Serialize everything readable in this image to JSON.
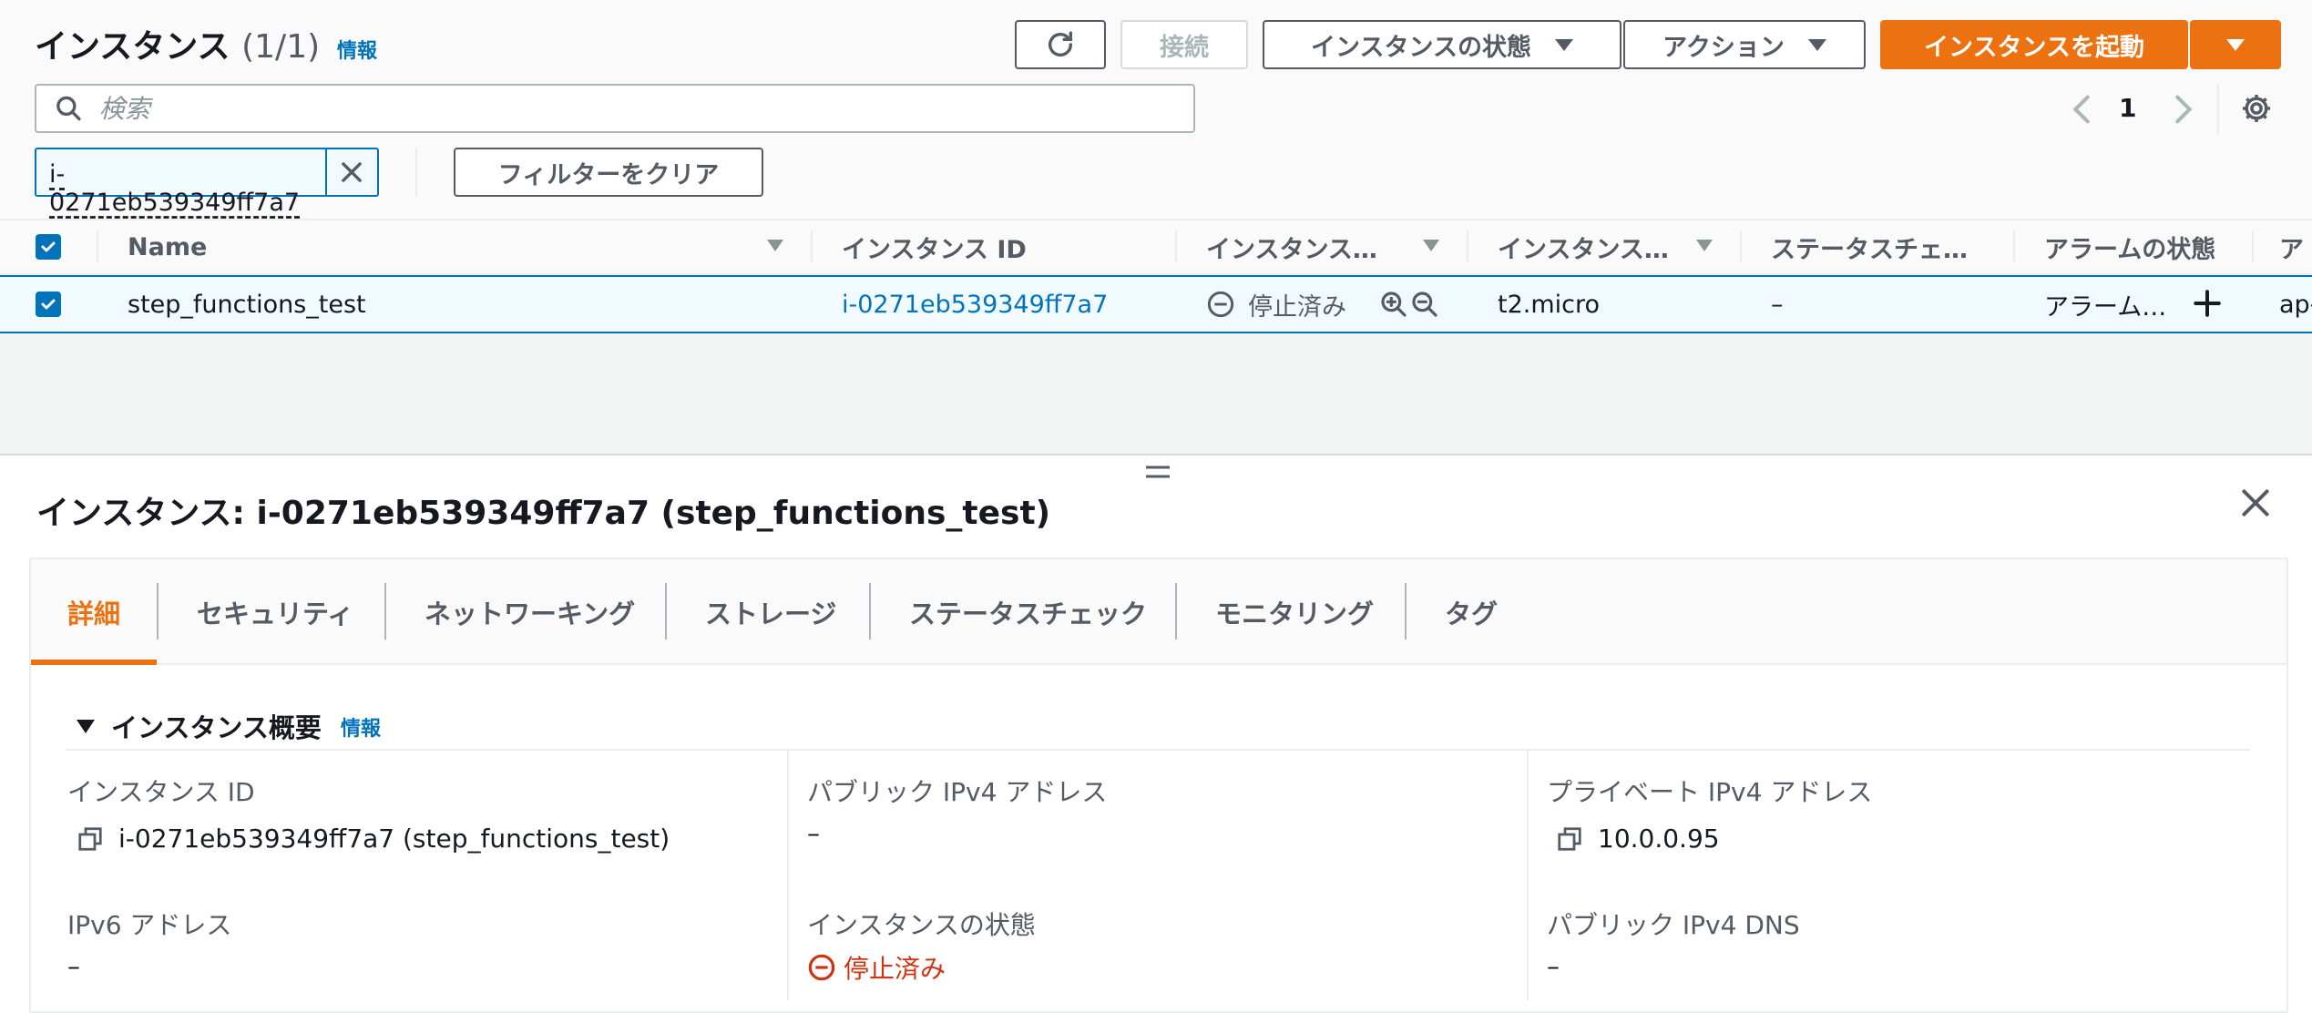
{
  "header": {
    "title": "インスタンス",
    "count": "(1/1)",
    "info": "情報"
  },
  "toolbar": {
    "connect_label": "接続",
    "instance_state_label": "インスタンスの状態",
    "actions_label": "アクション",
    "launch_label": "インスタンスを起動"
  },
  "search": {
    "placeholder": "検索"
  },
  "pagination": {
    "current_page": "1"
  },
  "filter": {
    "token": "i-0271eb539349ff7a7",
    "clear_label": "フィルターをクリア"
  },
  "table": {
    "columns": [
      "Name",
      "インスタンス ID",
      "インスタンス…",
      "インスタンス…",
      "ステータスチェ…",
      "アラームの状態",
      "ア"
    ],
    "row": {
      "name": "step_functions_test",
      "instance_id": "i-0271eb539349ff7a7",
      "state": "停止済み",
      "type": "t2.micro",
      "status_check": "–",
      "alarm": "アラーム…",
      "az": "ap-"
    }
  },
  "detail": {
    "title": "インスタンス: i-0271eb539349ff7a7 (step_functions_test)",
    "tabs": [
      "詳細",
      "セキュリティ",
      "ネットワーキング",
      "ストレージ",
      "ステータスチェック",
      "モニタリング",
      "タグ"
    ],
    "section_title": "インスタンス概要",
    "section_info": "情報",
    "fields": {
      "instance_id_label": "インスタンス ID",
      "instance_id_value": "i-0271eb539349ff7a7 (step_functions_test)",
      "public_ipv4_label": "パブリック IPv4 アドレス",
      "public_ipv4_value": "–",
      "private_ipv4_label": "プライベート IPv4 アドレス",
      "private_ipv4_value": "10.0.0.95",
      "ipv6_label": "IPv6 アドレス",
      "ipv6_value": "–",
      "state_label": "インスタンスの状態",
      "state_value": "停止済み",
      "public_dns_label": "パブリック IPv4 DNS",
      "public_dns_value": "–"
    }
  },
  "colors": {
    "accent": "#ec7211",
    "link": "#0073bb",
    "stopped": "#d13212"
  },
  "icons": [
    "refresh-icon",
    "search-icon",
    "chevron-left-icon",
    "chevron-right-icon",
    "gear-icon",
    "close-icon",
    "zoom-in-icon",
    "zoom-out-icon",
    "plus-icon",
    "copy-icon",
    "stopped-status-icon",
    "resize-handle-icon"
  ]
}
